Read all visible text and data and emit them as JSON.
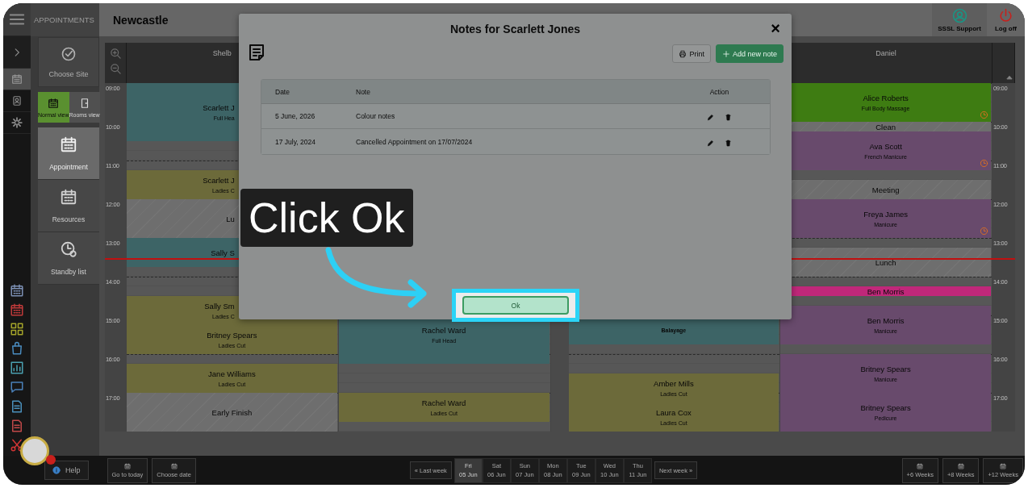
{
  "rail": {
    "top": [
      {
        "kind": "menu",
        "selected": false
      },
      {
        "kind": "chevron",
        "selected": false
      },
      {
        "kind": "calendar",
        "selected": true
      },
      {
        "kind": "contacts",
        "selected": false
      },
      {
        "kind": "settings",
        "selected": false
      }
    ],
    "tools": [
      {
        "kind": "calendar",
        "color": "#7c90b4"
      },
      {
        "kind": "calendar",
        "color": "#c03a3a"
      },
      {
        "kind": "grid",
        "color": "#a4a42a"
      },
      {
        "kind": "bag",
        "color": "#4a8cc0"
      },
      {
        "kind": "chart",
        "color": "#4aa0b0"
      },
      {
        "kind": "chat",
        "color": "#4a80b8"
      },
      {
        "kind": "document",
        "color": "#4a90bc"
      },
      {
        "kind": "document",
        "color": "#c04848"
      },
      {
        "kind": "scissors",
        "color": "#d03434"
      }
    ]
  },
  "sidebar": {
    "title": "APPOINTMENTS",
    "choose_site": "Choose Site",
    "views": [
      {
        "kind": "calendar",
        "label": "Normal view",
        "selected": true
      },
      {
        "kind": "door",
        "label": "Rooms view",
        "selected": false
      }
    ],
    "menu": [
      {
        "kind": "calendar",
        "label": "Appointment",
        "selected": true
      },
      {
        "kind": "calendar",
        "label": "Resources",
        "selected": false
      },
      {
        "kind": "clock",
        "label": "Standby list",
        "selected": false
      }
    ]
  },
  "header": {
    "site": "Newcastle",
    "actions": [
      {
        "kind": "support",
        "label": "SSSL Support"
      },
      {
        "kind": "logoff",
        "label": "Log off"
      }
    ]
  },
  "calendar": {
    "times_left": [
      "09:00",
      "10:00",
      "11:00",
      "12:00",
      "13:00",
      "14:00",
      "15:00",
      "16:00",
      "17:00"
    ],
    "times_right": [
      "09:00",
      "10:00",
      "11:00",
      "12:00",
      "13:00",
      "14:00",
      "15:00",
      "16:00",
      "17:00"
    ],
    "now_line": {
      "level": 0.503
    },
    "columns": [
      {
        "name": "Shelb",
        "events": [
          {
            "kind": "appointment",
            "name": "Scarlett J",
            "service": "Full Hea",
            "color": "#3d6466"
          },
          {
            "kind": "appointment",
            "name": "Scarlett J",
            "service": "Ladies C",
            "color": "#6c6a3a"
          },
          {
            "kind": "break",
            "label": "Lu"
          },
          {
            "kind": "appointment",
            "name": "Sally S",
            "color": "#3d6466"
          },
          {
            "kind": "appointment",
            "name": "Sally Sm",
            "service": "Ladies C",
            "color": "#6c6a3a",
            "clock": false
          },
          {
            "kind": "appointment",
            "name": "Britney Spears",
            "service": "Ladies Cut",
            "color": "#6c6a3a",
            "clock": false
          },
          {
            "kind": "appointment",
            "name": "Jane Williams",
            "service": "Ladies Cut",
            "color": "#6c6a3a",
            "clock": false
          },
          {
            "kind": "break",
            "label": "Early Finish"
          }
        ]
      },
      {
        "events": [
          {
            "kind": "appointment",
            "name": "Rachel Ward",
            "service": "Full Head",
            "color": "#3d6466",
            "clock": false
          },
          {
            "kind": "appointment",
            "name": "Rachel Ward",
            "service": "Ladies Cut",
            "color": "#6c6a3a",
            "clock": false
          }
        ]
      },
      {
        "events": [
          {
            "kind": "appointment",
            "service": "Balayage",
            "color": "#3d6466",
            "clock": false
          },
          {
            "kind": "appointment",
            "name": "Amber Mills",
            "service": "Ladies Cut",
            "color": "#6c6a3a",
            "clock": false
          },
          {
            "kind": "appointment",
            "name": "Laura Cox",
            "service": "Ladies Cut",
            "color": "#6c6a3a",
            "clock": false
          }
        ]
      },
      {
        "name": "Daniel",
        "events": [
          {
            "kind": "appointment",
            "name": "Alice Roberts",
            "service": "Full Body Massage",
            "color": "#3e7c12",
            "clock": true
          },
          {
            "kind": "break",
            "label": "Clean"
          },
          {
            "kind": "appointment",
            "name": "Ava Scott",
            "service": "French Manicure",
            "color": "#684a6c",
            "clock": true
          },
          {
            "kind": "break",
            "label": "Meeting"
          },
          {
            "kind": "appointment",
            "name": "Freya James",
            "service": "Manicure",
            "color": "#684a6c",
            "clock": true
          },
          {
            "kind": "break",
            "label": "Lunch"
          },
          {
            "kind": "appointment",
            "name": "Ben Morris",
            "color": "#c0287a",
            "clock": false
          },
          {
            "kind": "appointment",
            "name": "Ben Morris",
            "service": "Manicure",
            "color": "#684a6c",
            "clock": false
          },
          {
            "kind": "appointment",
            "name": "Britney Spears",
            "service": "Manicure",
            "color": "#684a6c",
            "clock": false
          },
          {
            "kind": "appointment",
            "name": "Britney Spears",
            "service": "Pedicure",
            "color": "#684a6c",
            "clock": false
          }
        ]
      }
    ]
  },
  "modal": {
    "title": "Notes for Scarlett Jones",
    "close": "×",
    "buttons": [
      {
        "kind": "print",
        "label": "Print"
      },
      {
        "kind": "add",
        "label": "Add new note"
      }
    ],
    "table": {
      "columns": [
        "Date",
        "Note",
        "Action"
      ],
      "rows": [
        {
          "date": "5 June, 2026",
          "note": "Colour notes"
        },
        {
          "date": "17 July, 2024",
          "note": "Cancelled Appointment on 17/07/2024"
        }
      ]
    },
    "ok": "Ok"
  },
  "tour": {
    "callout": "Click Ok"
  },
  "bottom": {
    "help": "Help",
    "left": [
      "Go to today",
      "Choose date"
    ],
    "prev": "« Last week",
    "days": [
      {
        "day": "Fri",
        "date": "05 Jun",
        "selected": true
      },
      {
        "day": "Sat",
        "date": "06 Jun",
        "selected": false
      },
      {
        "day": "Sun",
        "date": "07 Jun",
        "selected": false
      },
      {
        "day": "Mon",
        "date": "08 Jun",
        "selected": false
      },
      {
        "day": "Tue",
        "date": "09 Jun",
        "selected": false
      },
      {
        "day": "Wed",
        "date": "10 Jun",
        "selected": false
      },
      {
        "day": "Thu",
        "date": "11 Jun",
        "selected": false
      }
    ],
    "next": "Next week »",
    "jumps": [
      "+6 Weeks",
      "+8 Weeks",
      "+12 Weeks"
    ]
  }
}
